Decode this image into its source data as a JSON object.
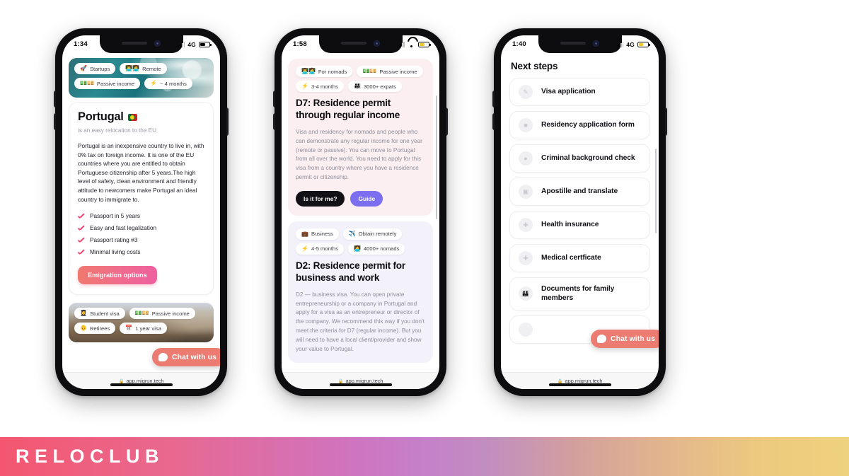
{
  "banner": {
    "brand": "RELOCLUB"
  },
  "phones": [
    {
      "id": "phone-country",
      "status": {
        "time": "1:34",
        "network": "4G",
        "battery_color": "#000000",
        "battery_level": 62,
        "connection_icon": "cell-bars-icon"
      },
      "url": "app.migrun.tech",
      "hero_pills": [
        {
          "emoji": "🚀",
          "label": "Startups"
        },
        {
          "emoji": "👨‍💻👩‍💻",
          "label": "Remote"
        },
        {
          "emoji": "💵💴",
          "label": "Passive income"
        },
        {
          "emoji": "⚡",
          "label": "~ 4 months"
        }
      ],
      "title": "Portugal",
      "flag": "portugal-flag-icon",
      "subtitle": "is an easy relocation to the EU",
      "body": "Portugal is an inexpensive country to live in, with 0% tax on foreign income. It is one of the EU countries where you are entitled to obtain Portuguese citizenship after 5 years.The high level of safety, clean environment and friendly attitude to newcomers make Portugal an ideal country to immigrate to.",
      "checks": [
        "Passport in 5 years",
        "Easy and fast legalization",
        "Passport rating #3",
        "Minimal living costs"
      ],
      "cta": "Emigration options",
      "hero2_pills": [
        {
          "emoji": "👩‍🎓",
          "label": "Student visa"
        },
        {
          "emoji": "💵💴",
          "label": "Passive income"
        },
        {
          "emoji": "👴",
          "label": "Retirees"
        },
        {
          "emoji": "📅",
          "label": "1 year visa"
        }
      ],
      "chat": "Chat with us"
    },
    {
      "id": "phone-visas",
      "status": {
        "time": "1:58",
        "network": "wifi",
        "battery_color": "#f3c623",
        "battery_level": 55,
        "connection_icon": "wifi-icon"
      },
      "url": "app.migrun.tech",
      "cards": [
        {
          "theme": "pink",
          "pills": [
            {
              "emoji": "👨‍💻👩‍💻",
              "label": "For nomads"
            },
            {
              "emoji": "💵💴",
              "label": "Passive income"
            },
            {
              "emoji": "⚡",
              "label": "3-4 months"
            },
            {
              "emoji": "👨‍👩‍👧",
              "label": "3000+ expats"
            }
          ],
          "title": "D7: Residence permit through regular income",
          "paragraph": "Visa and residency for nomads and people who can demonstrate any regular income for one year (remote or passive). You can move to Portugal from all over the world. You need to apply for this visa from a country where you have a residence permit or citizenship.",
          "buttons": [
            {
              "label": "Is it for me?",
              "style": "dark"
            },
            {
              "label": "Guide",
              "style": "indigo"
            }
          ]
        },
        {
          "theme": "lavender",
          "pills": [
            {
              "emoji": "💼",
              "label": "Business"
            },
            {
              "emoji": "✈️",
              "label": "Obtain remotely"
            },
            {
              "emoji": "⚡",
              "label": "4-5 months"
            },
            {
              "emoji": "👩‍💻",
              "label": "4000+ nomads"
            }
          ],
          "title": "D2: Residence permit for business and work",
          "paragraph": "D2 — business visa. You can open private entrepreneurship or a company in Portugal and apply for a visa as an entrepreneur or director of the company. We recommend this way if you don't meet the criteria for D7 (regular income). But you will need to have a local client/provider and show your value to Portugal.",
          "buttons": []
        }
      ]
    },
    {
      "id": "phone-next-steps",
      "status": {
        "time": "1:40",
        "network": "4G",
        "battery_color": "#f3c623",
        "battery_level": 50,
        "connection_icon": "cell-bars-icon"
      },
      "url": "app.migrun.tech",
      "heading": "Next steps",
      "steps": [
        {
          "icon": "document-edit-icon",
          "label": "Visa application"
        },
        {
          "icon": "form-icon",
          "label": "Residency application form"
        },
        {
          "icon": "shield-check-icon",
          "label": "Criminal background check"
        },
        {
          "icon": "stamp-icon",
          "label": "Apostille and translate"
        },
        {
          "icon": "briefcase-medical-icon",
          "label": "Health insurance"
        },
        {
          "icon": "briefcase-medical-icon",
          "label": "Medical certficate"
        },
        {
          "icon": "family-icon",
          "label": "Documents for family members"
        }
      ],
      "chat": "Chat with us"
    }
  ]
}
